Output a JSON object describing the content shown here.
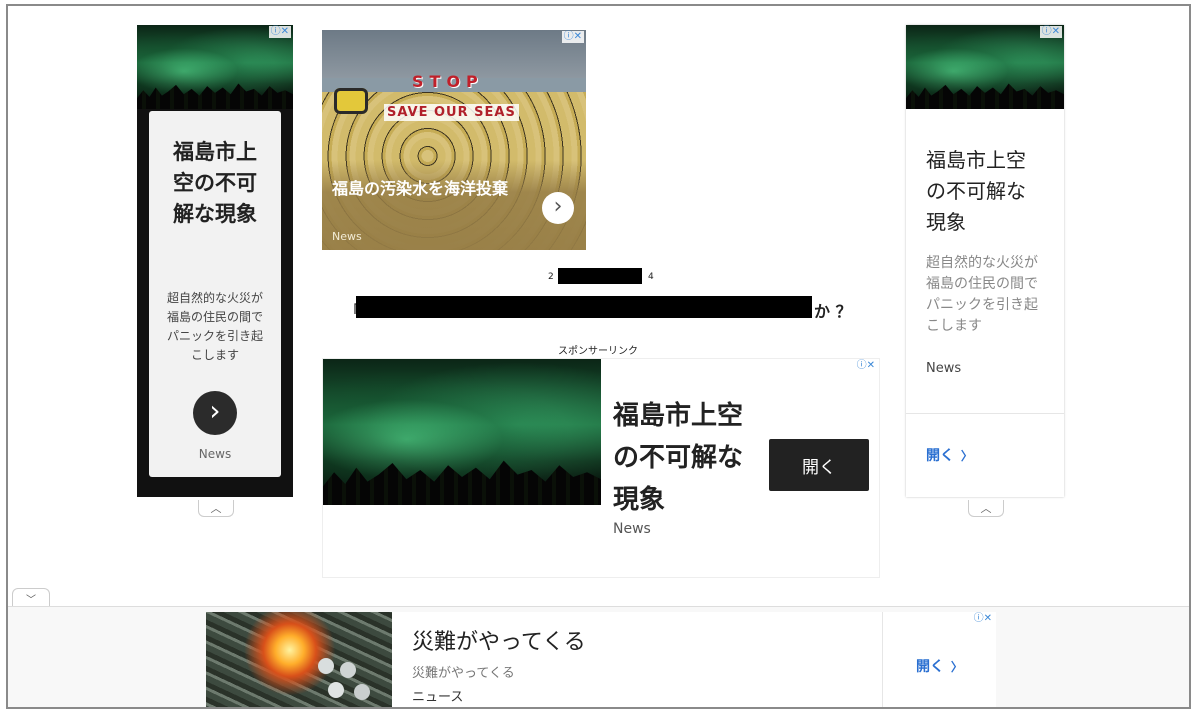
{
  "ad_choice": "ⓘ✕",
  "left_ad": {
    "title": "福島市上空の不可解な現象",
    "body": "超自然的な火災が福島の住民の間でパニックを引き起こします",
    "source": "News"
  },
  "top_ad": {
    "headline": "福島の汚染水を海洋投棄",
    "source": "News",
    "sign_top": "STOP",
    "sign_bottom": "SAVE OUR SEAS"
  },
  "article": {
    "meta_left": "2",
    "meta_right": "4",
    "title_open": "「",
    "title_end": "か ？"
  },
  "sponsor_label": "スポンサーリンク",
  "center_ad": {
    "title": "福島市上空の不可解な現象",
    "source": "News",
    "open_button": "開く"
  },
  "right_ad": {
    "title": "福島市上空の不可解な現象",
    "body": "超自然的な火災が福島の住民の間でパニックを引き起こします",
    "source": "News",
    "open_link": "開く"
  },
  "bottom_ad": {
    "title": "災難がやってくる",
    "subtitle": "災難がやってくる",
    "source": "ニュース",
    "open_link": "開く"
  },
  "icons": {
    "arrow_right": "›",
    "chevron_up": "︿",
    "chevron_down": "﹀",
    "chevron_right_small": "〉"
  }
}
